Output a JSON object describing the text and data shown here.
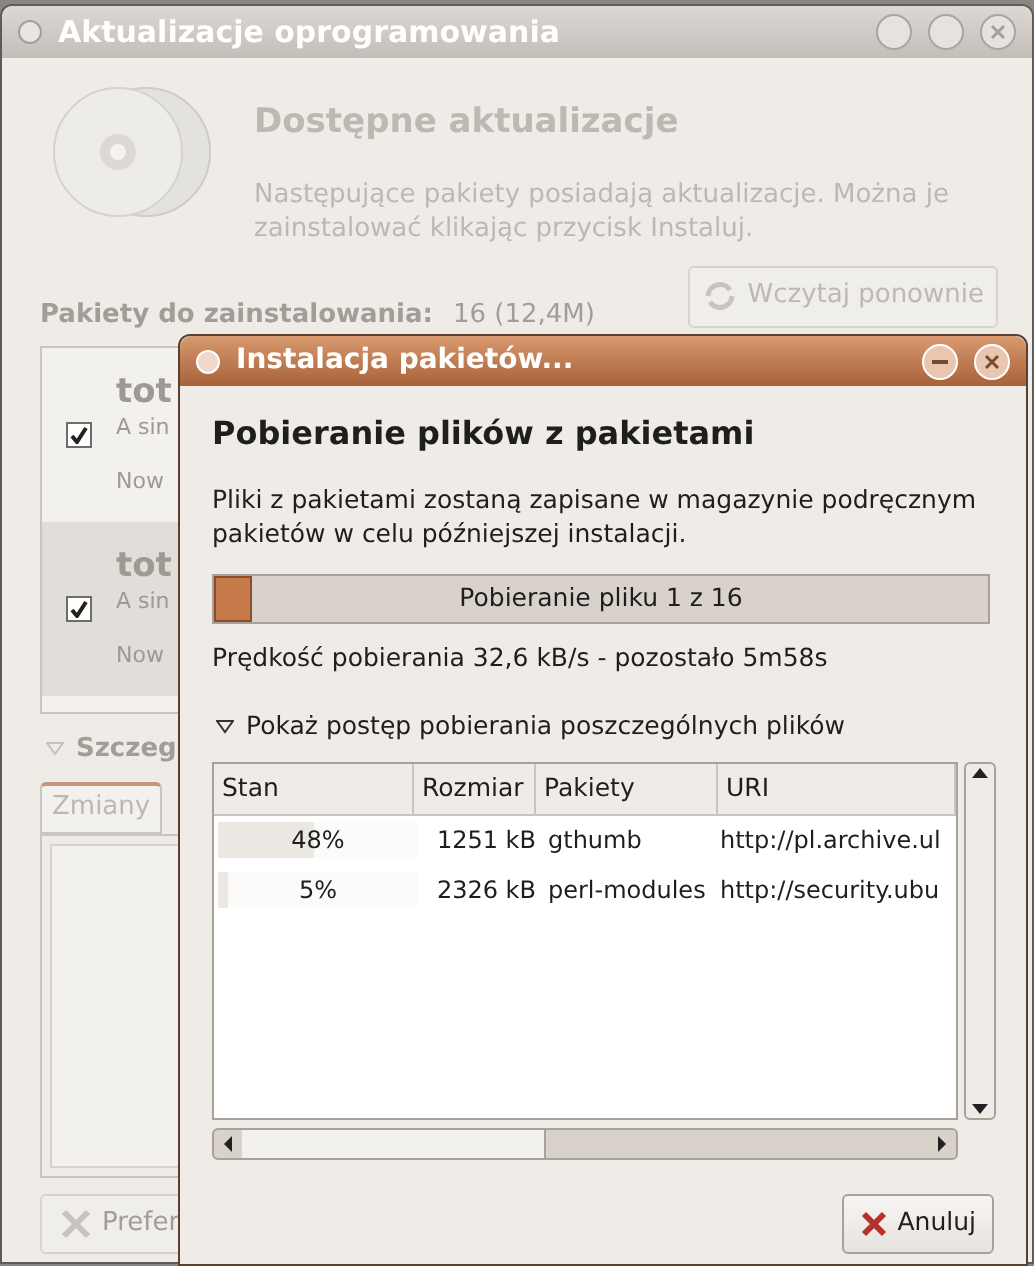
{
  "main_window": {
    "title": "Aktualizacje oprogramowania",
    "heading": "Dostępne aktualizacje",
    "description": "Następujące pakiety posiadają aktualizacje. Można je zainstalować klikając przycisk Instaluj.",
    "reload_button": "Wczytaj ponownie",
    "packages_label": "Pakiety do zainstalowania:",
    "packages_count": "16 (12,4M)",
    "packages": [
      {
        "name": "tot",
        "summary": "A sin",
        "version": "Now",
        "checked": true,
        "selected": false
      },
      {
        "name": "tot",
        "summary": "A sin",
        "version": "Now",
        "checked": true,
        "selected": true
      }
    ],
    "details_expander": {
      "label": "Szczeg",
      "expanded": true
    },
    "tabs": [
      {
        "label": "Zmiany",
        "selected": true
      }
    ],
    "preferences_button": "Prefer"
  },
  "dialog": {
    "title": "Instalacja pakietów...",
    "heading": "Pobieranie plików z pakietami",
    "description": "Pliki z pakietami zostaną zapisane w magazynie podręcznym pakietów w celu późniejszej instalacji.",
    "progress": {
      "level": 0.05,
      "text": "Pobieranie pliku 1 z 16"
    },
    "speed": "Prędkość pobierania 32,6 kB/s - pozostało 5m58s",
    "files_expander": {
      "label": "Pokaż postęp pobierania poszczególnych plików",
      "expanded": true
    },
    "table": {
      "columns": [
        "Stan",
        "Rozmiar",
        "Pakiety",
        "URI"
      ],
      "rows": [
        {
          "status": "48%",
          "level": 0.48,
          "size": "1251 kB",
          "package": "gthumb",
          "uri": "http://pl.archive.ul"
        },
        {
          "status": "5%",
          "level": 0.05,
          "size": "2326 kB",
          "package": "perl-modules",
          "uri": "http://security.ubu"
        }
      ]
    },
    "cancel_button": "Anuluj"
  }
}
